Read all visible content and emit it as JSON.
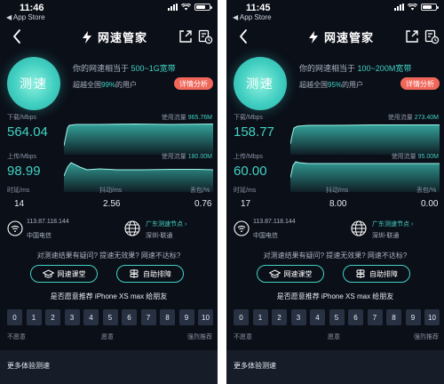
{
  "common": {
    "back_app": "◀ App Store",
    "brand_title": "网速管家",
    "speed_button": "测速",
    "equivalent_prefix": "你的网速相当于",
    "beat_prefix": "超越全国",
    "beat_suffix": "的用户",
    "detail_button": "详情分析",
    "download_label": "下载/Mbps",
    "upload_label": "上传/Mbps",
    "usage_label": "使用流量",
    "latency_label": "时延/ms",
    "jitter_label": "抖动/ms",
    "loss_label": "丢包/%",
    "ip": "113.87.118.144",
    "isp": "中国电信",
    "node_label": "广东测速节点 ›",
    "node_city": "深圳-联通",
    "question": "对测速结果有疑问? 提速无效果? 网速不达标?",
    "course_button": "网速课堂",
    "troubleshoot_button": "自助排障",
    "recommend": "是否愿意推荐 iPhone XS max 给朋友",
    "nps_scale": [
      "0",
      "1",
      "2",
      "3",
      "4",
      "5",
      "6",
      "7",
      "8",
      "9",
      "10"
    ],
    "nps_low": "不愿意",
    "nps_mid": "愿意",
    "nps_high": "强烈推荐",
    "more_title": "更多体验测速",
    "colors": {
      "accent": "#41d3c5",
      "detail": "#f0675a",
      "background": "#0b0f18"
    }
  },
  "phones": [
    {
      "time": "11:46",
      "band": "500~1G宽带",
      "beat_percent": "99%",
      "download": "564.04",
      "download_usage": "965.76M",
      "upload": "98.99",
      "upload_usage": "180.00M",
      "latency": "14",
      "jitter": "2.56",
      "loss": "0.76"
    },
    {
      "time": "11:45",
      "band": "100~200M宽带",
      "beat_percent": "95%",
      "download": "158.77",
      "download_usage": "273.40M",
      "upload": "60.00",
      "upload_usage": "95.00M",
      "latency": "17",
      "jitter": "8.00",
      "loss": "0.00"
    }
  ]
}
